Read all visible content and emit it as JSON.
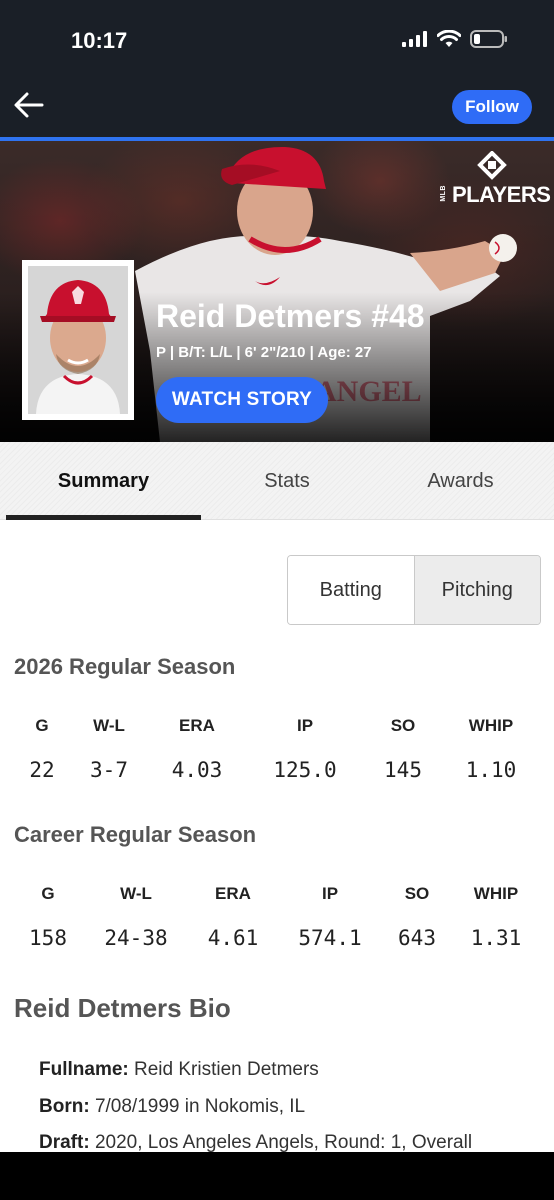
{
  "status_bar": {
    "time": "10:17"
  },
  "nav": {
    "follow_label": "Follow"
  },
  "hero": {
    "logo_text": "PLAYERS",
    "logo_small": "MLB",
    "player_name": "Reid Detmers #48",
    "meta": "P | B/T: L/L | 6' 2\"/210 | Age: 27",
    "watch_label": "WATCH STORY"
  },
  "tabs": [
    "Summary",
    "Stats",
    "Awards"
  ],
  "toggle": {
    "left": "Batting",
    "right": "Pitching",
    "selected": "Pitching"
  },
  "season": {
    "title": "2026 Regular Season",
    "headers": [
      "G",
      "W-L",
      "ERA",
      "IP",
      "SO",
      "WHIP"
    ],
    "values": [
      "22",
      "3-7",
      "4.03",
      "125.0",
      "145",
      "1.10"
    ]
  },
  "career": {
    "title": "Career Regular Season",
    "headers": [
      "G",
      "W-L",
      "ERA",
      "IP",
      "SO",
      "WHIP"
    ],
    "values": [
      "158",
      "24-38",
      "4.61",
      "574.1",
      "643",
      "1.31"
    ]
  },
  "bio": {
    "title": "Reid Detmers Bio",
    "lines": [
      {
        "label": "Fullname:",
        "value": "Reid Kristien Detmers"
      },
      {
        "label": "Born:",
        "value": "7/08/1999 in Nokomis, IL"
      },
      {
        "label": "Draft:",
        "value": "2020, Los Angeles Angels, Round: 1, Overall"
      }
    ]
  },
  "colors": {
    "accent": "#2f6cf6",
    "topbar": "#1a1f27"
  }
}
